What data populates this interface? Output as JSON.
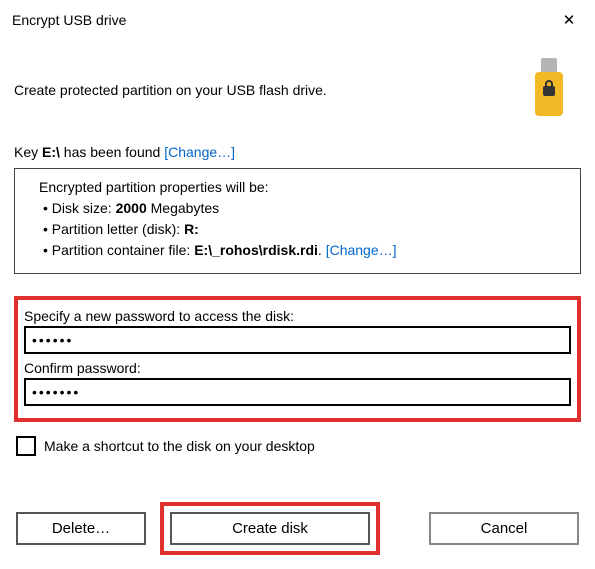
{
  "title": "Encrypt USB drive",
  "intro": "Create protected partition on your USB flash drive.",
  "key_row": {
    "prefix": "Key ",
    "drive": "E:\\",
    "suffix": " has been found    ",
    "change": "Change…"
  },
  "props": {
    "heading": "Encrypted partition properties will be:",
    "disk_size_label": "Disk size: ",
    "disk_size_value": "2000",
    "disk_size_unit": " Megabytes",
    "letter_label": "Partition letter (disk): ",
    "letter_value": "R:",
    "container_label": "Partition container file: ",
    "container_value": "E:\\_rohos\\rdisk.rdi",
    "container_dot": ".   ",
    "change": "Change…"
  },
  "password": {
    "label": "Specify a new password to access the disk:",
    "value": "••••••",
    "confirm_label": "Confirm password:",
    "confirm_value": "•••••••"
  },
  "shortcut": {
    "label": "Make a shortcut to the disk on your desktop",
    "checked": false
  },
  "buttons": {
    "delete": "Delete…",
    "create": "Create disk",
    "cancel": "Cancel"
  }
}
